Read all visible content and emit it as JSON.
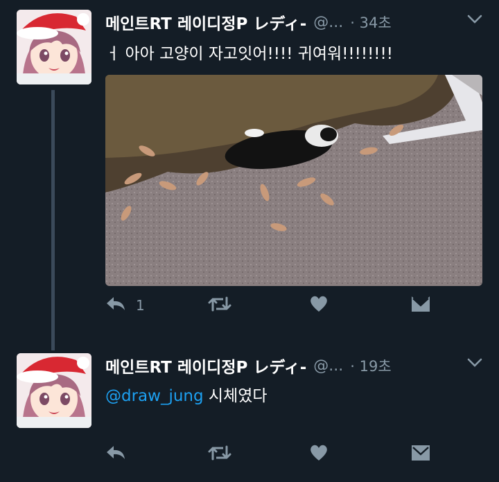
{
  "tweets": [
    {
      "name": "메인트RT 레이디정P レディ-",
      "handle": "@...",
      "time": "· 34초",
      "text": "ㅓ 아아 고양이 자고잇어!!!! 귀여워!!!!!!!!",
      "reply_count": "1"
    },
    {
      "name": "메인트RT 레이디정P レディ-",
      "handle": "@...",
      "time": "· 19초",
      "mention": "@draw_jung",
      "text": "시체였다",
      "reply_count": ""
    }
  ],
  "colors": {
    "background": "#141d26",
    "muted": "#8899a6",
    "link": "#1da1f2"
  },
  "icons": [
    "reply-icon",
    "retweet-icon",
    "like-icon",
    "dm-icon",
    "chevron-down-icon"
  ]
}
